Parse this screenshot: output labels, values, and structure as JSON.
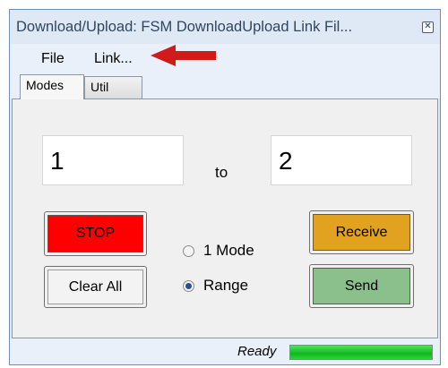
{
  "window": {
    "title": "Download/Upload: FSM DownloadUpload Link Fil..."
  },
  "menu": {
    "items": [
      "File",
      "Link..."
    ]
  },
  "tabs": [
    {
      "label": "Modes",
      "active": true
    },
    {
      "label": "Util",
      "active": false
    }
  ],
  "modes": {
    "from_value": "1",
    "to_label": "to",
    "to_value": "2",
    "stop_label": "STOP",
    "clear_label": "Clear All",
    "receive_label": "Receive",
    "send_label": "Send",
    "radio_options": [
      {
        "label": "1 Mode",
        "selected": false
      },
      {
        "label": "Range",
        "selected": true
      }
    ]
  },
  "status": {
    "text": "Ready",
    "progress_fraction": 1.0
  },
  "colors": {
    "stop": "#ff0000",
    "receive": "#e0a21f",
    "send": "#8bbf8b",
    "progress": "#16c024",
    "arrow": "#d11a1a"
  },
  "icons": {
    "close": "close-icon",
    "annotation": "red-arrow-icon"
  }
}
